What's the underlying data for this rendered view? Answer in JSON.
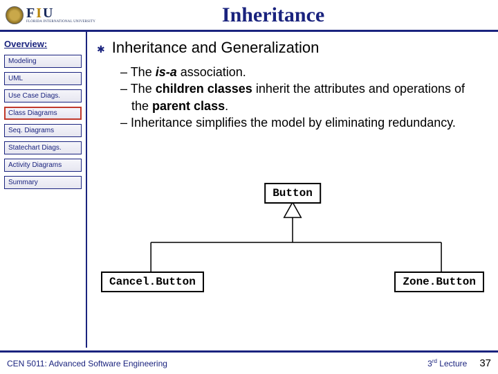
{
  "header": {
    "logo_main": "FIU",
    "logo_sub": "FLORIDA INTERNATIONAL UNIVERSITY",
    "title": "Inheritance"
  },
  "sidebar": {
    "label": "Overview:",
    "items": [
      "Modeling",
      "UML",
      "Use Case Diags.",
      "Class Diagrams",
      "Seq. Diagrams",
      "Statechart Diags.",
      "Activity Diagrams",
      "Summary"
    ],
    "active_index": 3
  },
  "content": {
    "heading": "Inheritance and Generalization",
    "bullets": [
      {
        "pre": "The ",
        "b1": "is-a",
        "post": " association."
      },
      {
        "pre": "The ",
        "b1": "children classes",
        "mid": " inherit the attributes and operations of the ",
        "b2": "parent class",
        "post": "."
      },
      {
        "pre": "Inheritance simplifies the model by eliminating redundancy."
      }
    ]
  },
  "diagram": {
    "parent": "Button",
    "left": "Cancel.Button",
    "right": "Zone.Button"
  },
  "footer": {
    "course": "CEN 5011: Advanced Software Engineering",
    "lecture_pre": "3",
    "lecture_sup": "rd",
    "lecture_post": " Lecture",
    "page": "37"
  }
}
